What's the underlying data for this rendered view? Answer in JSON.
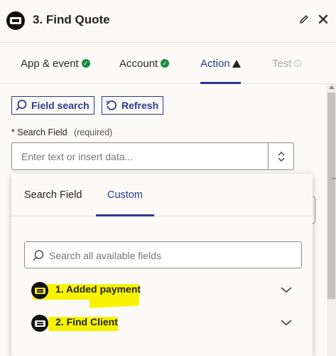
{
  "header": {
    "step_title": "3. Find Quote"
  },
  "tabs": [
    {
      "label": "App & event",
      "state": "complete"
    },
    {
      "label": "Account",
      "state": "complete"
    },
    {
      "label": "Action",
      "state": "warning"
    },
    {
      "label": "Test",
      "state": "disabled"
    }
  ],
  "toolbar": {
    "field_search_label": "Field search",
    "refresh_label": "Refresh"
  },
  "search_field": {
    "asterisk": "*",
    "label": "Search Field",
    "required": "(required)",
    "placeholder": "Enter text or insert data..."
  },
  "dropdown": {
    "tabs": [
      {
        "label": "Search Field",
        "active": false
      },
      {
        "label": "Custom",
        "active": true
      }
    ],
    "search_placeholder": "Search all available fields",
    "items": [
      {
        "label": "1. Added payment"
      },
      {
        "label": "2. Find Client"
      }
    ]
  },
  "colors": {
    "accent": "#2b3990",
    "success": "#1a8a3a",
    "highlight": "#f7f300",
    "background": "#fbfaf7"
  },
  "icons": [
    "app-logo-icon",
    "edit-icon",
    "close-icon",
    "check-icon",
    "warning-icon",
    "info-icon",
    "search-icon",
    "refresh-icon",
    "stepper-icon",
    "chevron-down-icon"
  ]
}
